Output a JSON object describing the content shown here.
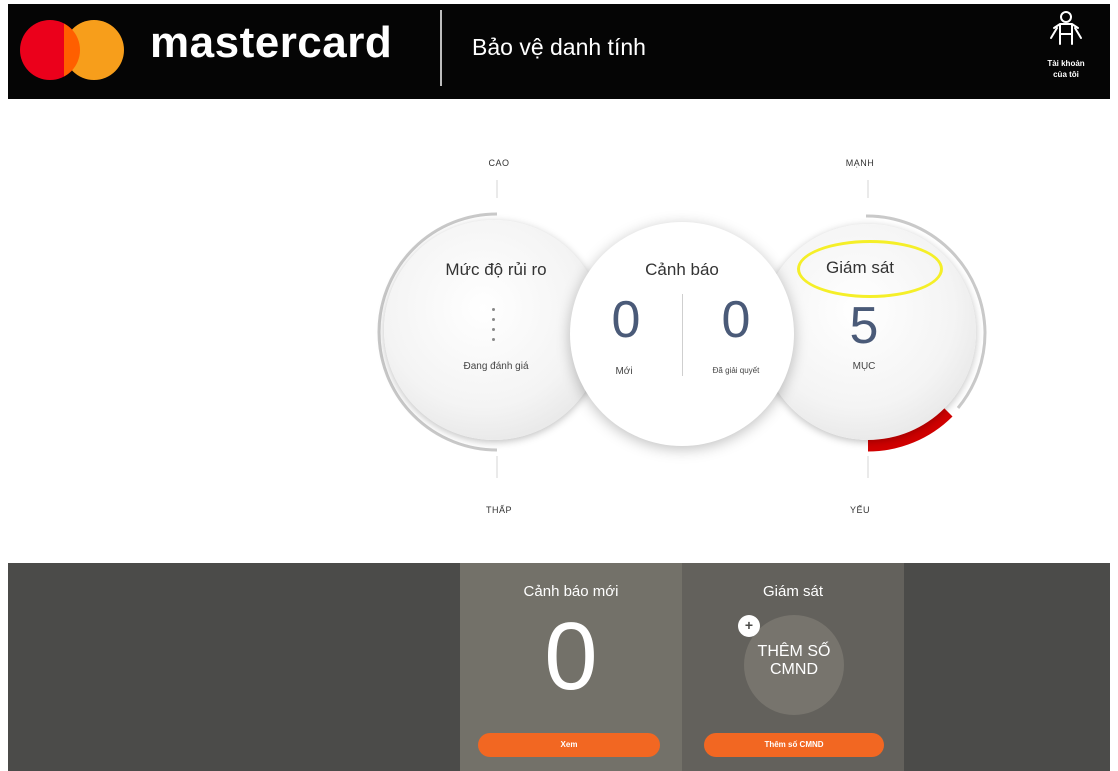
{
  "header": {
    "brand": "mastercard",
    "product_title": "Bảo vệ danh tính",
    "account_label_line1": "Tài khoản",
    "account_label_line2": "của tôi"
  },
  "gauge": {
    "left_scale": {
      "top_label": "CAO",
      "bottom_label": "THẤP"
    },
    "right_scale": {
      "top_label": "MẠNH",
      "bottom_label": "YẾU"
    },
    "risk": {
      "title": "Mức độ rủi ro",
      "status": "Đang đánh giá"
    },
    "alerts": {
      "title": "Cảnh báo",
      "new_count": "0",
      "new_label": "Mới",
      "resolved_count": "0",
      "resolved_label": "Đã giải quyết"
    },
    "monitoring": {
      "title": "Giám sát",
      "count": "5",
      "unit": "MỤC",
      "strength_level": 0.25
    }
  },
  "bottom": {
    "alerts_panel": {
      "title": "Cảnh báo mới",
      "count": "0",
      "button": "Xem"
    },
    "monitor_panel": {
      "title": "Giám sát",
      "add_line1": "THÊM SỐ",
      "add_line2": "CMND",
      "plus": "+",
      "button": "Thêm số CMND"
    }
  },
  "colors": {
    "mc_red": "#eb001b",
    "mc_yellow": "#f79e1b",
    "accent_orange": "#f26722",
    "strength_red": "#d00000",
    "highlight_yellow": "#f5ef28"
  }
}
